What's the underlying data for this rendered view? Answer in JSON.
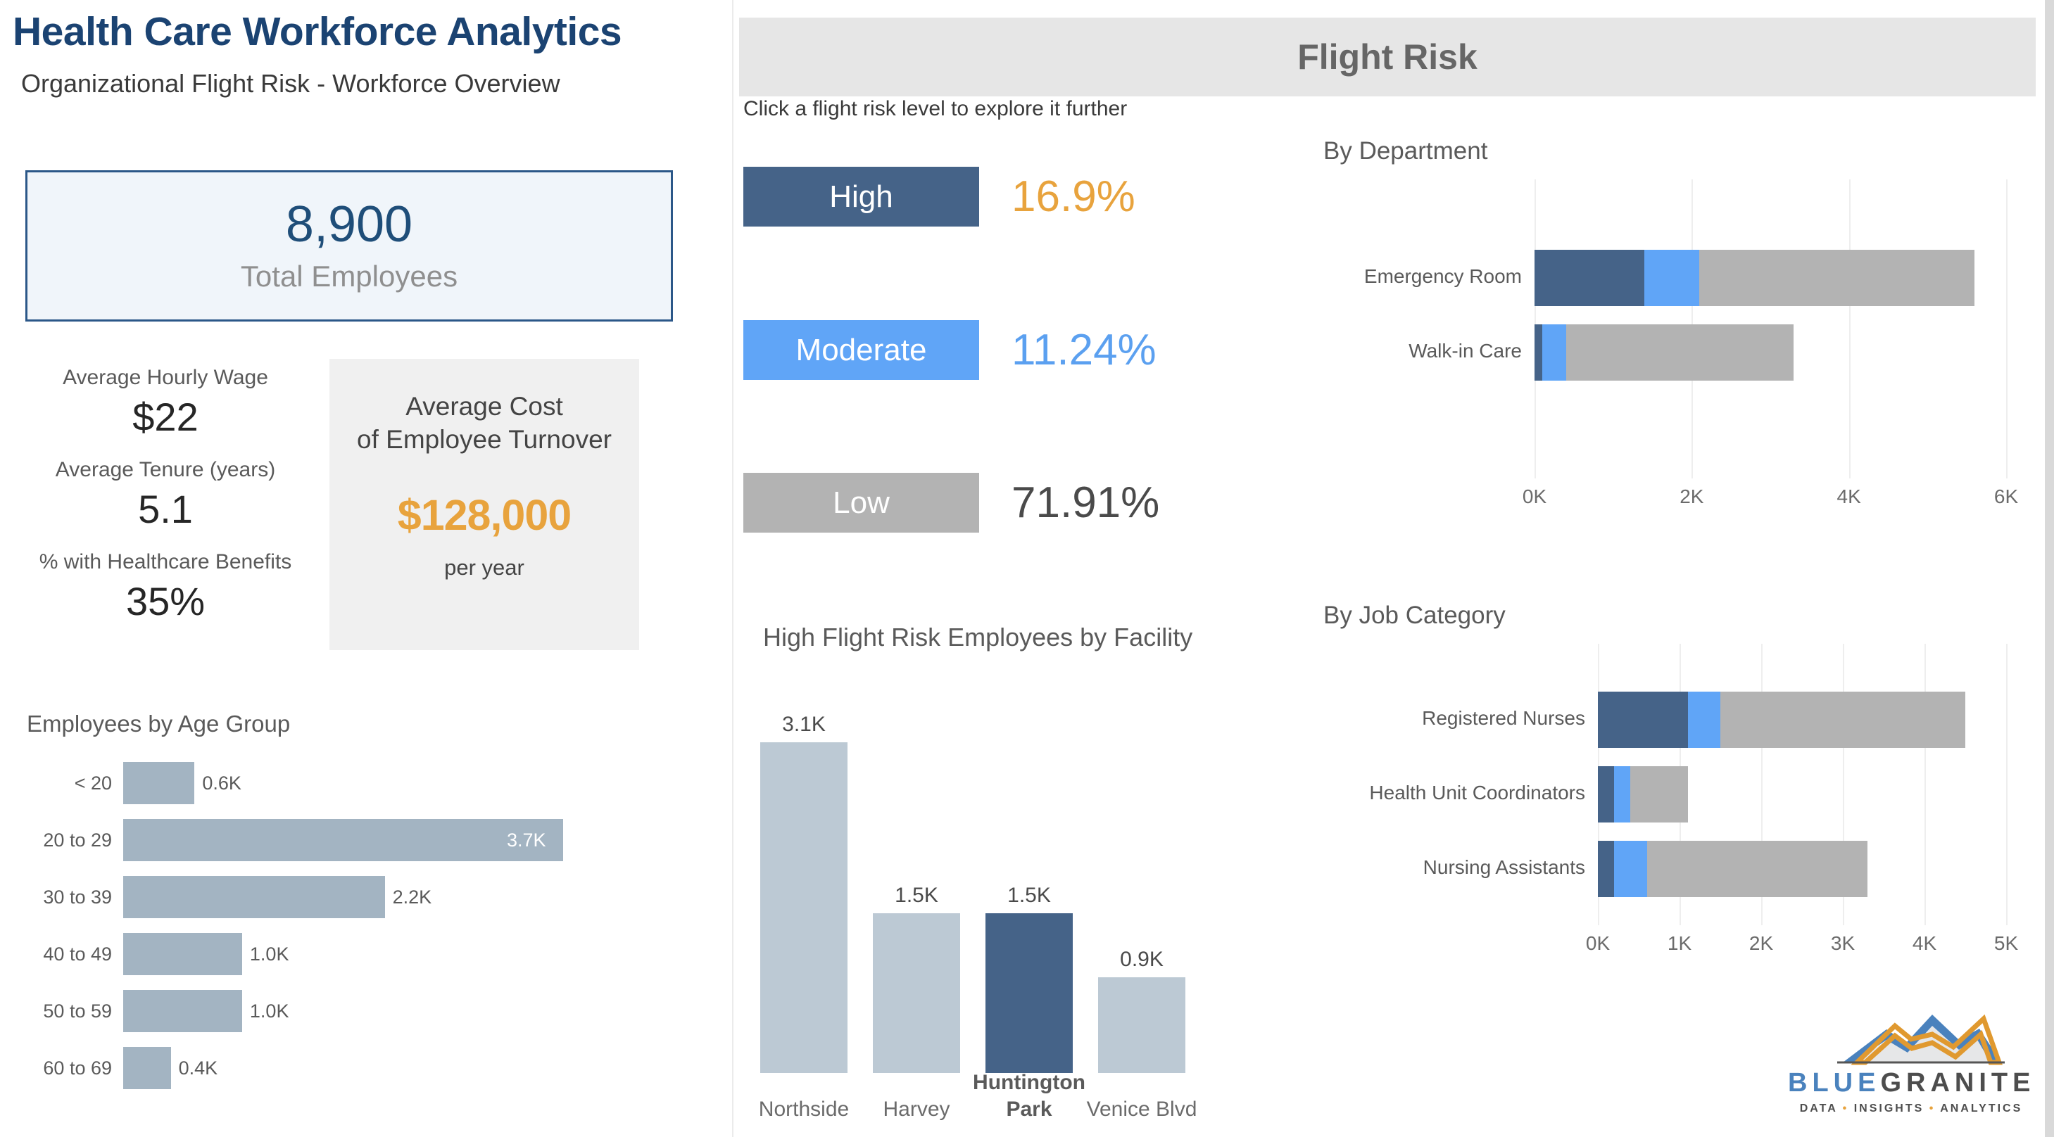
{
  "header": {
    "main_title": "Health Care Workforce Analytics",
    "sub_title": "Organizational Flight Risk - Workforce Overview",
    "flight_risk_title": "Flight Risk",
    "hint": "Click a flight risk level to explore it further"
  },
  "kpi": {
    "value": "8,900",
    "label": "Total Employees"
  },
  "metrics": [
    {
      "label": "Average Hourly Wage",
      "value": "$22"
    },
    {
      "label": "Average Tenure (years)",
      "value": "5.1"
    },
    {
      "label": "% with Healthcare Benefits",
      "value": "35%"
    }
  ],
  "cost_card": {
    "title_line1": "Average Cost",
    "title_line2": "of Employee Turnover",
    "value": "$128,000",
    "sub": "per year"
  },
  "risk_levels": [
    {
      "label": "High",
      "percent": "16.9%",
      "chip_color": "#456388",
      "pct_color": "#e8a33d"
    },
    {
      "label": "Moderate",
      "percent": "11.24%",
      "chip_color": "#60a5f7",
      "pct_color": "#5ba0f0"
    },
    {
      "label": "Low",
      "percent": "71.91%",
      "chip_color": "#b3b3b3",
      "pct_color": "#4a4a4a"
    }
  ],
  "colors": {
    "title_blue": "#1b4372",
    "accent_orange": "#e8a33d",
    "high": "#456388",
    "moderate": "#60a5f7",
    "low": "#b3b3b3",
    "bar_grey_blue": "#a3b4c2",
    "card_bg": "#f0f5fa",
    "card_border": "#2b5788"
  },
  "logo": {
    "word_blue": "BLUE",
    "word_grey": "GRANITE",
    "tagline_1": "DATA",
    "tagline_dot": "•",
    "tagline_2": "INSIGHTS",
    "tagline_3": "ANALYTICS"
  },
  "chart_data": [
    {
      "type": "bar",
      "orientation": "horizontal",
      "title": "Employees by Age Group",
      "xlabel": "",
      "ylabel": "",
      "categories": [
        "< 20",
        "20 to 29",
        "30 to 39",
        "40 to 49",
        "50 to 59",
        "60 to 69"
      ],
      "values": [
        0.6,
        3.7,
        2.2,
        1.0,
        1.0,
        0.4
      ],
      "data_labels": [
        "0.6K",
        "3.7K",
        "2.2K",
        "1.0K",
        "1.0K",
        "0.4K"
      ],
      "xlim": [
        0,
        3.7
      ],
      "grid": false,
      "legend": "none",
      "series_color": "#a3b4c2"
    },
    {
      "type": "bar",
      "orientation": "vertical",
      "title": "High Flight Risk Employees by Facility",
      "categories": [
        "Northside",
        "Harvey",
        "Huntington Park",
        "Venice Blvd"
      ],
      "values": [
        3.1,
        1.5,
        1.5,
        0.9
      ],
      "data_labels": [
        "3.1K",
        "1.5K",
        "1.5K",
        "0.9K"
      ],
      "highlighted_category": "Huntington Park",
      "ylim": [
        0,
        3.1
      ],
      "grid": false,
      "legend": "none",
      "series_color": "#bcc9d4",
      "highlight_color": "#456388"
    },
    {
      "type": "bar",
      "orientation": "horizontal",
      "stacked": true,
      "title": "By Department",
      "categories": [
        "Emergency Room",
        "Walk-in Care"
      ],
      "series": [
        {
          "name": "High",
          "color": "#456388",
          "values": [
            1400,
            100
          ]
        },
        {
          "name": "Moderate",
          "color": "#60a5f7",
          "values": [
            700,
            300
          ]
        },
        {
          "name": "Low",
          "color": "#b3b3b3",
          "values": [
            3500,
            2900
          ]
        }
      ],
      "totals": [
        5600,
        3300
      ],
      "xlim": [
        0,
        6000
      ],
      "xticks": [
        "0K",
        "2K",
        "4K",
        "6K"
      ],
      "xtick_values": [
        0,
        2000,
        4000,
        6000
      ],
      "grid": true,
      "legend": "none"
    },
    {
      "type": "bar",
      "orientation": "horizontal",
      "stacked": true,
      "title": "By Job Category",
      "categories": [
        "Registered Nurses",
        "Health Unit Coordinators",
        "Nursing Assistants"
      ],
      "series": [
        {
          "name": "High",
          "color": "#456388",
          "values": [
            1100,
            200,
            200
          ]
        },
        {
          "name": "Moderate",
          "color": "#60a5f7",
          "values": [
            400,
            200,
            400
          ]
        },
        {
          "name": "Low",
          "color": "#b3b3b3",
          "values": [
            3000,
            700,
            2700
          ]
        }
      ],
      "totals": [
        4500,
        1100,
        3300
      ],
      "xlim": [
        0,
        5000
      ],
      "xticks": [
        "0K",
        "1K",
        "2K",
        "3K",
        "4K",
        "5K"
      ],
      "xtick_values": [
        0,
        1000,
        2000,
        3000,
        4000,
        5000
      ],
      "grid": true,
      "legend": "none"
    }
  ]
}
